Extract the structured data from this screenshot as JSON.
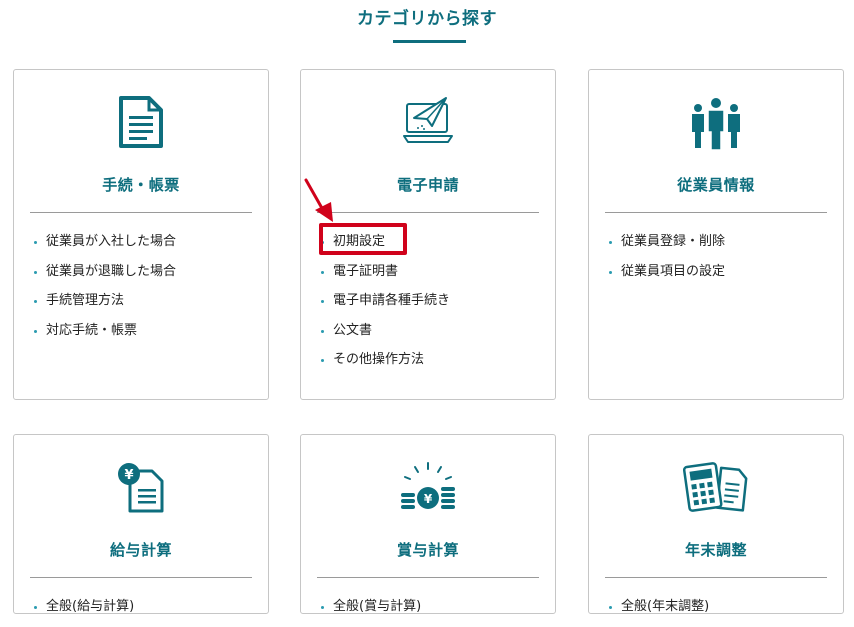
{
  "page": {
    "section_title": "カテゴリから探す"
  },
  "theme": {
    "accent": "#0e6e7e",
    "bullet": "#2a9bb0",
    "annotation": "#d0021b"
  },
  "cards": [
    {
      "title": "手続・帳票",
      "icon": "document-icon",
      "links": [
        "従業員が入社した場合",
        "従業員が退職した場合",
        "手続管理方法",
        "対応手続・帳票"
      ]
    },
    {
      "title": "電子申請",
      "icon": "laptop-paper-plane-icon",
      "links": [
        "初期設定",
        "電子証明書",
        "電子申請各種手続き",
        "公文書",
        "その他操作方法"
      ]
    },
    {
      "title": "従業員情報",
      "icon": "people-group-icon",
      "links": [
        "従業員登録・削除",
        "従業員項目の設定"
      ]
    },
    {
      "title": "給与計算",
      "icon": "yen-document-icon",
      "links": [
        "全般(給与計算)"
      ]
    },
    {
      "title": "賞与計算",
      "icon": "yen-coins-icon",
      "links": [
        "全般(賞与計算)"
      ]
    },
    {
      "title": "年末調整",
      "icon": "calculator-document-icon",
      "links": [
        "全般(年末調整)"
      ]
    }
  ],
  "annotation": {
    "target": "初期設定",
    "shape": "red-box-with-arrow"
  }
}
